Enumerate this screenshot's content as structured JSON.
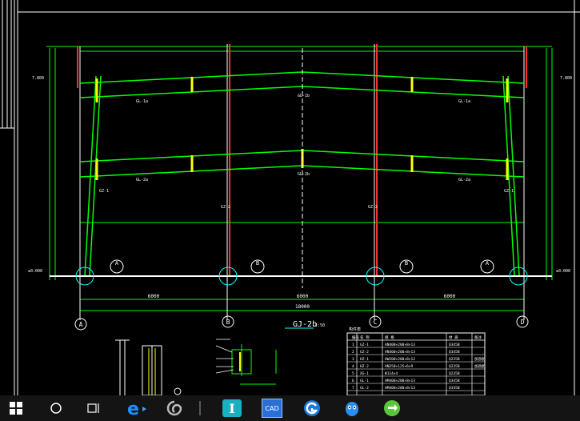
{
  "drawing": {
    "frame_title": "GJ-2b",
    "frame_scale": "1:50",
    "beam_label_top": "GL-1b",
    "beam_label_mid": "GL-2b",
    "beam_label_left_top": "GL-1a",
    "beam_label_right_top": "GL-1a",
    "beam_label_left_mid": "GL-2a",
    "beam_label_right_mid": "GL-2a",
    "col_label_left": "GZ-1",
    "col_label_right": "GZ-1",
    "col_label_mid_left": "GZ-2",
    "col_label_mid_right": "GZ-2",
    "axis_bubbles": [
      "A",
      "B",
      "C",
      "D"
    ],
    "section_marks": [
      "A",
      "B",
      "B",
      "A"
    ],
    "elev_left_top": "7.800",
    "elev_left_ground": "±0.000",
    "elev_right_top": "7.800",
    "elev_right_ground": "±0.000",
    "dim_total": "18000",
    "dim_spans": [
      "6000",
      "6000",
      "6000"
    ],
    "table_title": "构件表",
    "table_headers": [
      "编号",
      "名 称",
      "规 格",
      "材 质",
      "备注"
    ],
    "table_rows": [
      [
        "1",
        "GZ-1",
        "HN400×200×8×13",
        "Q345B",
        ""
      ],
      [
        "2",
        "GZ-2",
        "HN400×200×8×13",
        "Q345B",
        ""
      ],
      [
        "3",
        "HZ-1",
        "HW200×200×8×12",
        "Q235B",
        "加劲肋"
      ],
      [
        "4",
        "HZ-2",
        "HN250×125×6×9",
        "Q235B",
        "加劲肋"
      ],
      [
        "5",
        "XG-1",
        "Φ114×4",
        "Q235B",
        ""
      ],
      [
        "6",
        "GL-1",
        "HM400×200×8×13",
        "Q345B",
        ""
      ],
      [
        "7",
        "GL-2",
        "HM400×200×8×13",
        "Q345B",
        ""
      ]
    ]
  },
  "taskbar": {
    "start": "windows-start",
    "search": "search",
    "taskview": "task-view",
    "apps": [
      "Internet Explorer",
      "360 Browser",
      "Text Tool",
      "CAD",
      "Browser G",
      "QQ",
      "Green App"
    ],
    "app_cad_label": "CAD",
    "app_text_label": "I"
  }
}
